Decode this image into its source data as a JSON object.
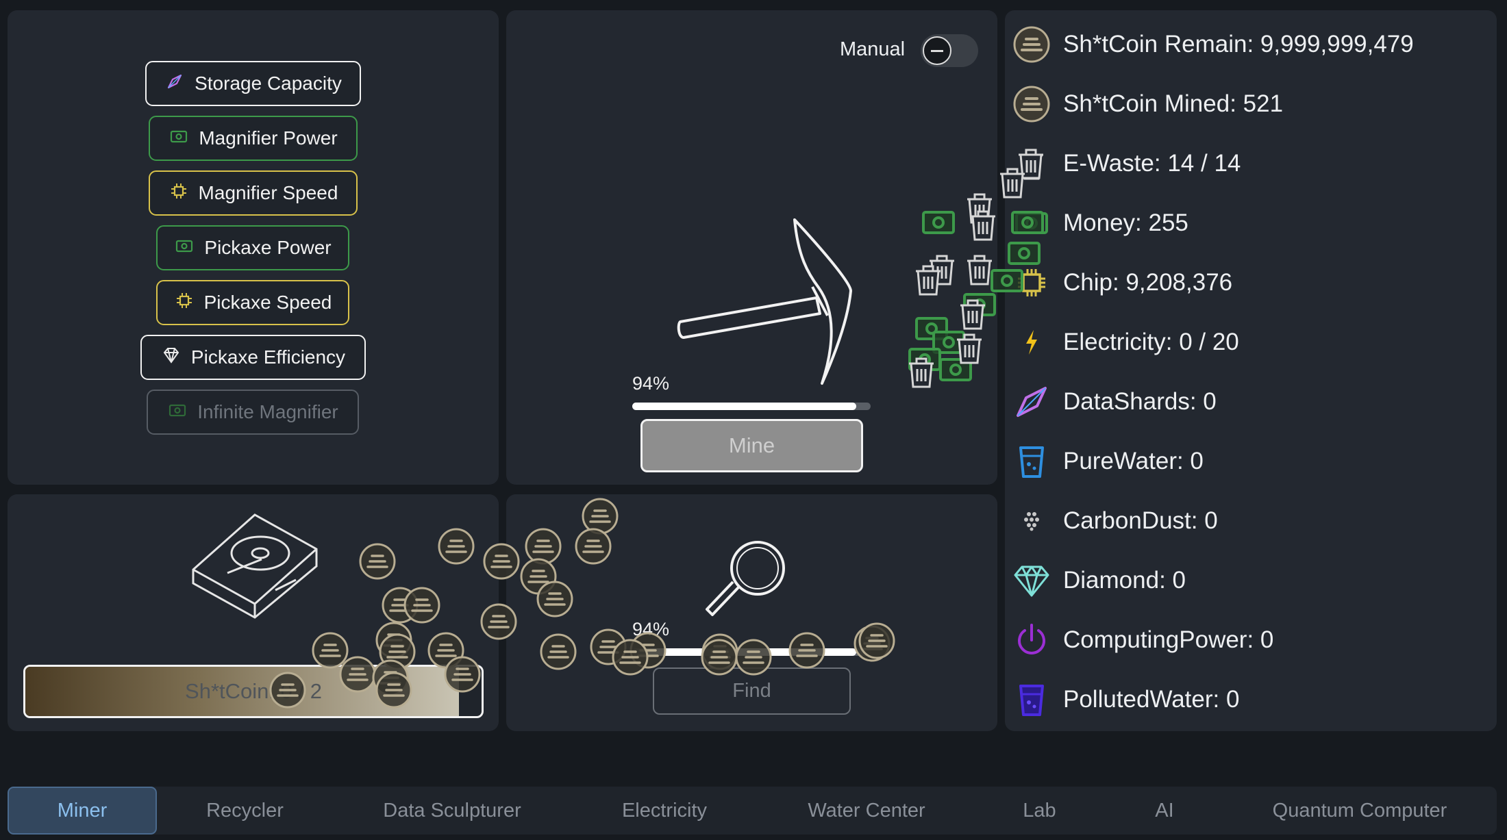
{
  "upgrades": [
    {
      "label": "Storage Capacity",
      "icon": "datashard-icon",
      "style": "white"
    },
    {
      "label": "Magnifier Power",
      "icon": "money-icon",
      "style": "green"
    },
    {
      "label": "Magnifier Speed",
      "icon": "chip-icon",
      "style": "yellow"
    },
    {
      "label": "Pickaxe Power",
      "icon": "money-icon",
      "style": "green"
    },
    {
      "label": "Pickaxe Speed",
      "icon": "chip-icon",
      "style": "yellow"
    },
    {
      "label": "Pickaxe Efficiency",
      "icon": "diamond-icon",
      "style": "white"
    },
    {
      "label": "Infinite Magnifier",
      "icon": "money-icon",
      "style": "disabled"
    }
  ],
  "mine": {
    "toggle_label": "Manual",
    "progress_text": "94%",
    "progress": 0.94,
    "button_label": "Mine"
  },
  "find": {
    "progress_text": "94%",
    "progress": 0.94,
    "button_label": "Find"
  },
  "storage": {
    "label": "Sh*tCoin: 0 / 2",
    "fill": 0.95
  },
  "resources": [
    {
      "label": "Sh*tCoin Remain: 9,999,999,479",
      "icon": "coin-icon"
    },
    {
      "label": "Sh*tCoin Mined: 521",
      "icon": "coin-icon"
    },
    {
      "label": "E-Waste: 14 / 14",
      "icon": "trash-icon"
    },
    {
      "label": "Money: 255",
      "icon": "money-icon"
    },
    {
      "label": "Chip: 9,208,376",
      "icon": "chip-icon"
    },
    {
      "label": "Electricity: 0 / 20",
      "icon": "bolt-icon"
    },
    {
      "label": "DataShards: 0",
      "icon": "datashard-icon"
    },
    {
      "label": "PureWater: 0",
      "icon": "water-glass-icon"
    },
    {
      "label": "CarbonDust: 0",
      "icon": "dust-icon"
    },
    {
      "label": "Diamond: 0",
      "icon": "diamond-icon"
    },
    {
      "label": "ComputingPower: 0",
      "icon": "power-icon"
    },
    {
      "label": "PollutedWater: 0",
      "icon": "polluted-water-icon"
    }
  ],
  "tabs": [
    {
      "label": "Miner",
      "active": true
    },
    {
      "label": "Recycler",
      "active": false
    },
    {
      "label": "Data Sculpturer",
      "active": false
    },
    {
      "label": "Electricity",
      "active": false
    },
    {
      "label": "Water Center",
      "active": false
    },
    {
      "label": "Lab",
      "active": false
    },
    {
      "label": "AI",
      "active": false
    },
    {
      "label": "Quantum Computer",
      "active": false
    }
  ],
  "colors": {
    "accent_green": "#3d9a4a",
    "accent_yellow": "#d8c24a",
    "coin": "#b8ad92",
    "bolt": "#f2c21a",
    "datashard": "#c070e8",
    "water": "#2e8fe0",
    "power": "#9b2fd4",
    "polluted": "#4b2be0",
    "tab_active": "#8cc0ee"
  }
}
